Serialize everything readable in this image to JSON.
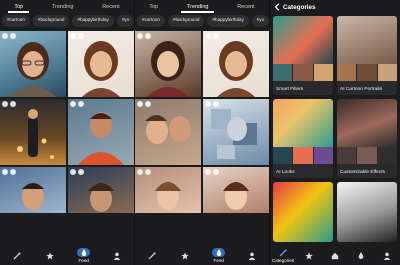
{
  "panel1": {
    "tabs": [
      {
        "label": "Top",
        "active": true
      },
      {
        "label": "Trending",
        "active": false
      },
      {
        "label": "Recent",
        "active": false
      }
    ],
    "chips": [
      "#cartoon",
      "#background",
      "#happybirthday",
      "#yo"
    ],
    "nav": [
      {
        "icon": "magic-wand-icon"
      },
      {
        "icon": "star-icon"
      },
      {
        "icon": "drop-icon",
        "label": "Feed",
        "active": true
      },
      {
        "icon": "person-icon"
      }
    ]
  },
  "panel2": {
    "tabs": [
      {
        "label": "Top",
        "active": false
      },
      {
        "label": "Trending",
        "active": true
      },
      {
        "label": "Recent",
        "active": false
      }
    ],
    "chips": [
      "#cartoon",
      "#background",
      "#happybirthday",
      "#yo"
    ],
    "nav": [
      {
        "icon": "magic-wand-icon"
      },
      {
        "icon": "star-icon"
      },
      {
        "icon": "drop-icon",
        "label": "Feed",
        "active": true
      },
      {
        "icon": "person-icon"
      }
    ]
  },
  "panel3": {
    "title": "Categories",
    "categories": [
      {
        "label": "Smart Filters"
      },
      {
        "label": "AI Cartoon Portraits"
      },
      {
        "label": "AI Looks"
      },
      {
        "label": "Customizable Effects"
      }
    ],
    "nav": [
      {
        "icon": "magic-wand-icon",
        "label": "Categories",
        "active": true
      },
      {
        "icon": "star-icon"
      },
      {
        "icon": "home-icon"
      },
      {
        "icon": "drop-icon"
      },
      {
        "icon": "person-icon"
      }
    ]
  },
  "colors": {
    "background": "#1c1c1e",
    "chip": "#2e2e31",
    "accent": "#2f6fb8"
  }
}
